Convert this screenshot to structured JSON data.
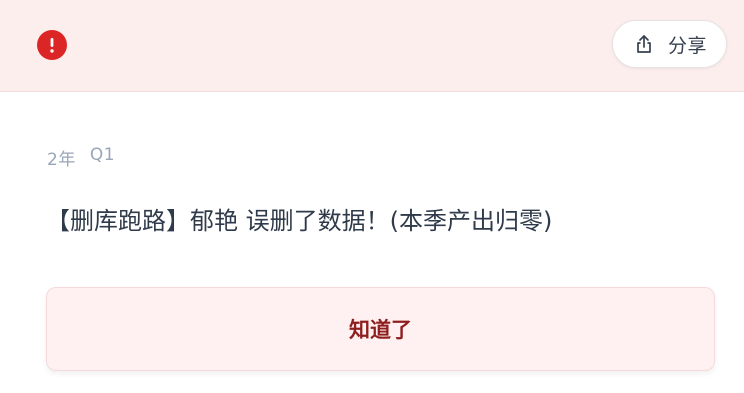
{
  "header": {
    "alert_icon": "exclamation-circle-icon",
    "alert_color": "#dc2626",
    "share_icon": "share-upload-icon",
    "share_label": "分享"
  },
  "event": {
    "year": "2年",
    "quarter": "Q1",
    "message": "【删库跑路】郁艳 误删了数据！(本季产出归零)"
  },
  "actions": {
    "acknowledge_label": "知道了"
  },
  "colors": {
    "header_background": "#fdeeee",
    "button_text": "#8f1f1f",
    "button_background": "#fff1f1"
  }
}
